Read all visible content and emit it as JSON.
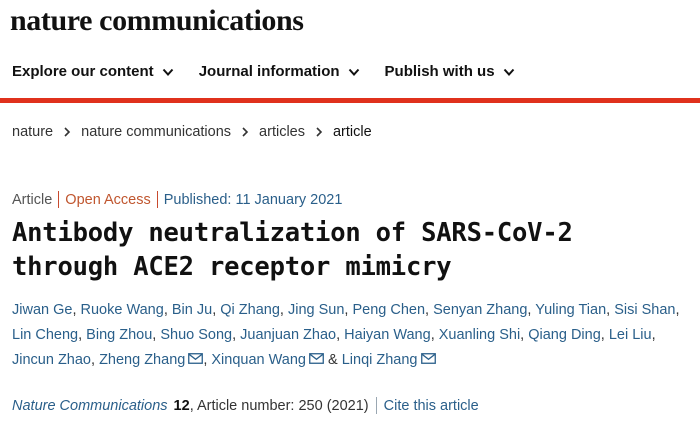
{
  "brand": {
    "name": "nature communications"
  },
  "nav": {
    "items": [
      {
        "label": "Explore our content"
      },
      {
        "label": "Journal information"
      },
      {
        "label": "Publish with us"
      }
    ]
  },
  "breadcrumb": {
    "items": [
      "nature",
      "nature communications",
      "articles"
    ],
    "current": "article"
  },
  "article": {
    "type": "Article",
    "access": "Open Access",
    "published": "Published: 11 January 2021",
    "title": "Antibody neutralization of SARS-CoV-2 through ACE2 receptor mimicry",
    "authors": [
      {
        "name": "Jiwan Ge",
        "mail": false
      },
      {
        "name": "Ruoke Wang",
        "mail": false
      },
      {
        "name": "Bin Ju",
        "mail": false
      },
      {
        "name": "Qi Zhang",
        "mail": false
      },
      {
        "name": "Jing Sun",
        "mail": false
      },
      {
        "name": "Peng Chen",
        "mail": false
      },
      {
        "name": "Senyan Zhang",
        "mail": false
      },
      {
        "name": "Yuling Tian",
        "mail": false
      },
      {
        "name": "Sisi Shan",
        "mail": false
      },
      {
        "name": "Lin Cheng",
        "mail": false
      },
      {
        "name": "Bing Zhou",
        "mail": false
      },
      {
        "name": "Shuo Song",
        "mail": false
      },
      {
        "name": "Juanjuan Zhao",
        "mail": false
      },
      {
        "name": "Haiyan Wang",
        "mail": false
      },
      {
        "name": "Xuanling Shi",
        "mail": false
      },
      {
        "name": "Qiang Ding",
        "mail": false
      },
      {
        "name": "Lei Liu",
        "mail": false
      },
      {
        "name": "Jincun Zhao",
        "mail": false
      },
      {
        "name": "Zheng Zhang",
        "mail": true
      },
      {
        "name": "Xinquan Wang",
        "mail": true
      },
      {
        "name": "Linqi Zhang",
        "mail": true
      }
    ],
    "amp": "&"
  },
  "citation": {
    "journal": "Nature Communications",
    "volume": "12",
    "article_number": ", Article number: 250 (2021)",
    "cite_label": "Cite this article"
  },
  "colors": {
    "accent_red": "#e0311c",
    "link_blue": "#2a5f8a",
    "open_access_orange": "#c0562f"
  },
  "icons": {
    "nav_chevron": "chevron-down-icon",
    "breadcrumb_sep": "chevron-right-icon",
    "author_mail": "mail-icon"
  }
}
